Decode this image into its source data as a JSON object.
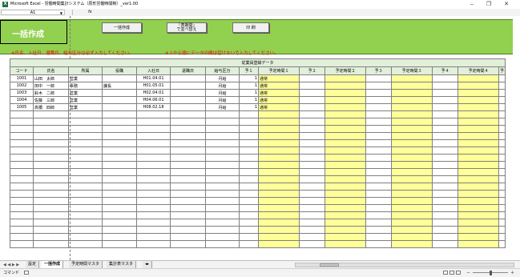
{
  "window": {
    "title": "Microsoft Excel - 労働時間集計システム（原形労働時間制）_ver1.00",
    "minimize": "‒",
    "restore": "❐",
    "close": "✕"
  },
  "formula_bar": {
    "name_box": "A1",
    "fx": "fx"
  },
  "sheet": {
    "title": "一括作成",
    "buttons": {
      "batch_create": "一括作成",
      "sort_line1": "「表期間」",
      "sort_line2": "で並べ替え",
      "print": "印 刷"
    },
    "notes": {
      "required": "※氏名、入社日、退職日、給与区分は必ず入力してください。",
      "no_gaps": "※上から順にデータの間は空けないで入力してください。"
    },
    "group_header": "従業員登録データ",
    "columns": [
      "コード",
      "氏名",
      "所属",
      "役職",
      "入社日",
      "退職日",
      "給与区分",
      "予１",
      "予定時間１",
      "予２",
      "予定時間２",
      "予３",
      "予定時間３",
      "予４",
      "予定時間４",
      "予"
    ],
    "rows": [
      {
        "code": "1001",
        "name": "山田　太郎",
        "dept": "営業",
        "role": "",
        "join": "H01.04.01",
        "leave": "",
        "pay": "月給",
        "y1": "1",
        "t1": "通常"
      },
      {
        "code": "1002",
        "name": "田中　一郎",
        "dept": "事務",
        "role": "課長",
        "join": "H01.05.01",
        "leave": "",
        "pay": "月給",
        "y1": "1",
        "t1": "通常"
      },
      {
        "code": "1003",
        "name": "鈴木　二郎",
        "dept": "営業",
        "role": "",
        "join": "H02.04.01",
        "leave": "",
        "pay": "月給",
        "y1": "1",
        "t1": "通常"
      },
      {
        "code": "1004",
        "name": "佐藤　三郎",
        "dept": "営業",
        "role": "",
        "join": "H04.06.01",
        "leave": "",
        "pay": "月給",
        "y1": "1",
        "t1": "通常"
      },
      {
        "code": "1005",
        "name": "高橋　四郎",
        "dept": "営業",
        "role": "",
        "join": "H08.02.18",
        "leave": "",
        "pay": "月給",
        "y1": "1",
        "t1": "通常"
      }
    ]
  },
  "tabs": {
    "nav": "◀ ◀ ▶ ▶",
    "items": [
      "設定",
      "一括作成",
      "予定時間マスタ",
      "集計表マスタ"
    ],
    "active_index": 1,
    "new_tab": "◂▸"
  },
  "status": {
    "mode": "コマンド"
  }
}
